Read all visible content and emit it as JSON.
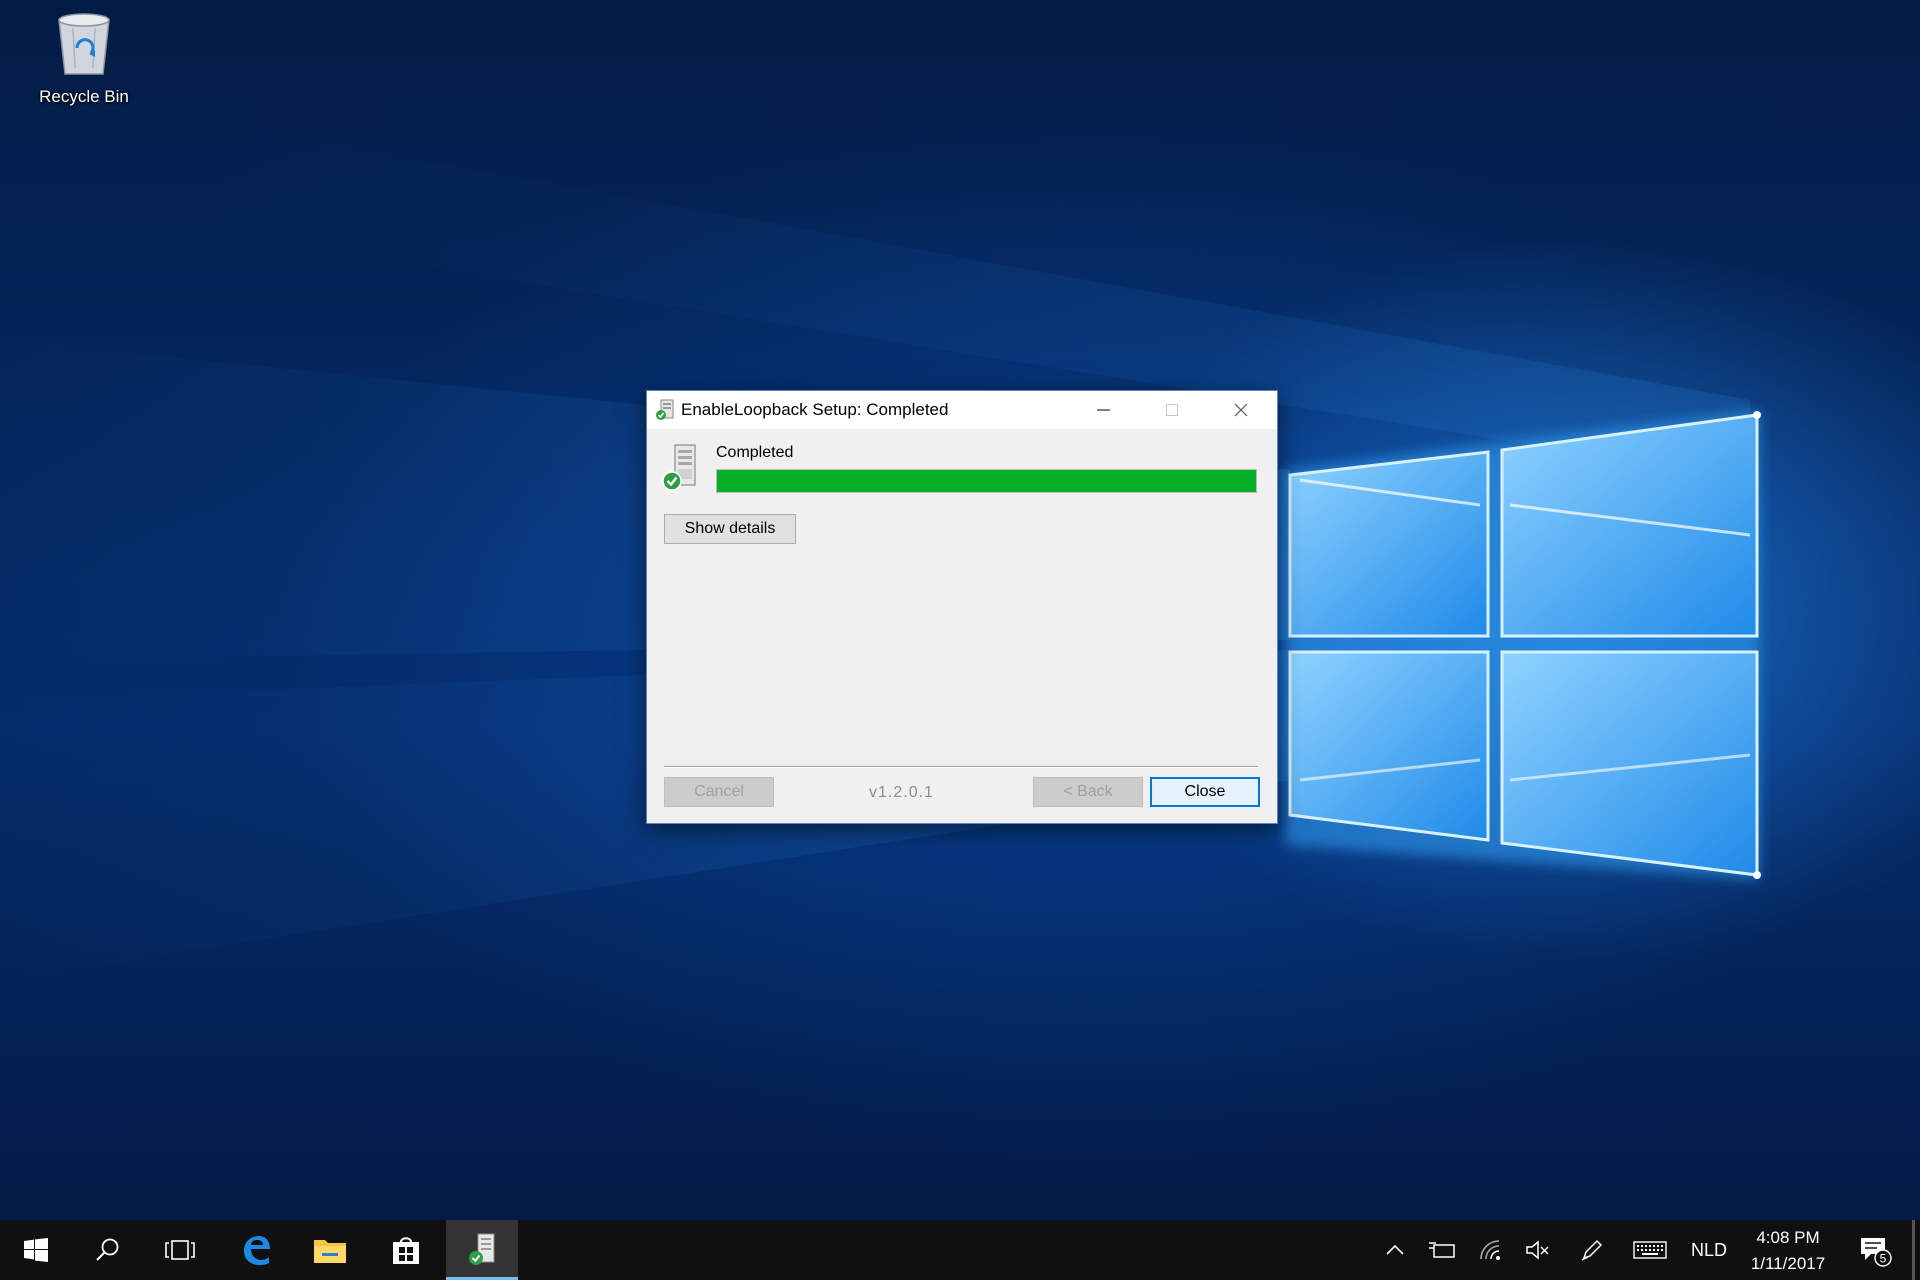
{
  "desktop": {
    "icons": [
      {
        "label": "Recycle Bin",
        "icon": "recycle-bin-icon"
      }
    ]
  },
  "dialog": {
    "title": "EnableLoopback Setup: Completed",
    "status_text": "Completed",
    "progress": 1.0,
    "progress_color": "#06b025",
    "show_details_label": "Show details",
    "cancel_label": "Cancel",
    "version": "v1.2.0.1",
    "back_label": "< Back",
    "close_label": "Close"
  },
  "taskbar": {
    "items": [
      "start-icon",
      "search-icon",
      "task-view-icon",
      "edge-icon",
      "file-explorer-icon",
      "store-icon",
      "installer-icon"
    ],
    "active_item": "installer-icon",
    "tray": {
      "language": "NLD",
      "time": "4:08 PM",
      "date": "1/11/2017",
      "notification_count": "5"
    }
  },
  "colors": {
    "accent": "#0078d7",
    "taskbar": "#101010"
  }
}
